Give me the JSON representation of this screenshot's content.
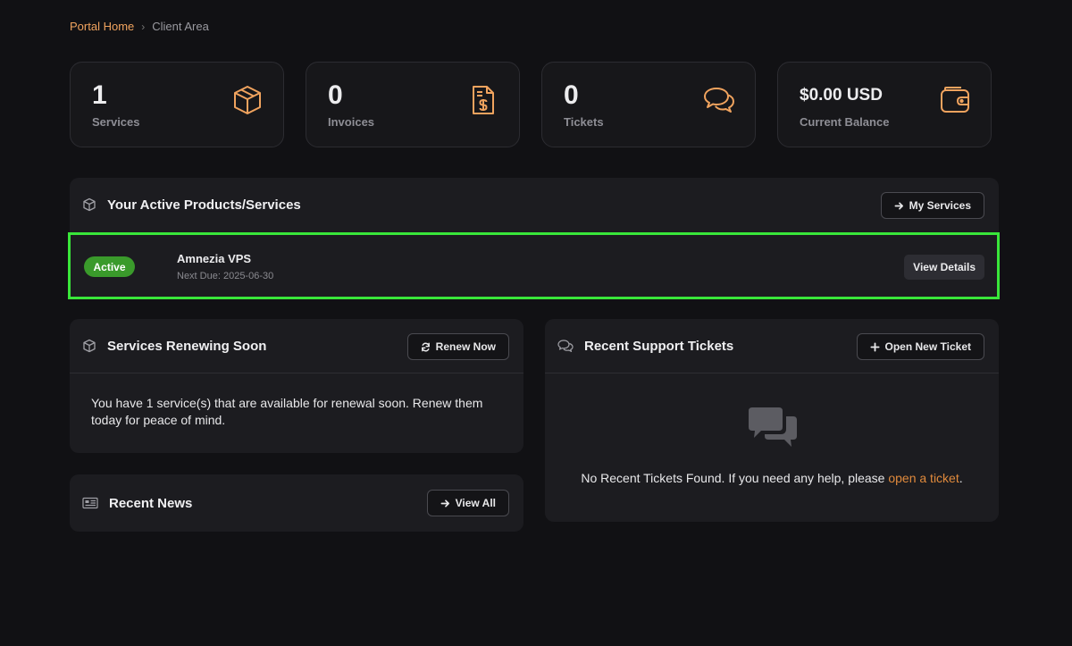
{
  "breadcrumb": {
    "home": "Portal Home",
    "separator": "›",
    "current": "Client Area"
  },
  "stats": [
    {
      "value": "1",
      "label": "Services",
      "icon": "cube-icon"
    },
    {
      "value": "0",
      "label": "Invoices",
      "icon": "invoice-icon"
    },
    {
      "value": "0",
      "label": "Tickets",
      "icon": "chat-bubbles-icon"
    },
    {
      "value": "$0.00 USD",
      "label": "Current Balance",
      "icon": "wallet-icon"
    }
  ],
  "active_services": {
    "title": "Your Active Products/Services",
    "button": "My Services",
    "items": [
      {
        "status": "Active",
        "name": "Amnezia VPS",
        "next_due": "Next Due: 2025-06-30",
        "action": "View Details"
      }
    ]
  },
  "renewing": {
    "title": "Services Renewing Soon",
    "button": "Renew Now",
    "text": "You have 1 service(s) that are available for renewal soon. Renew them today for peace of mind."
  },
  "news": {
    "title": "Recent News",
    "button": "View All"
  },
  "tickets": {
    "title": "Recent Support Tickets",
    "button": "Open New Ticket",
    "empty_text": "No Recent Tickets Found. If you need any help, please ",
    "link": "open a ticket",
    "after": "."
  },
  "colors": {
    "accent": "#f0a35e",
    "active_badge": "#3a9a2b",
    "highlight": "#39e63a",
    "background": "#111114",
    "panel": "#1c1c20"
  }
}
